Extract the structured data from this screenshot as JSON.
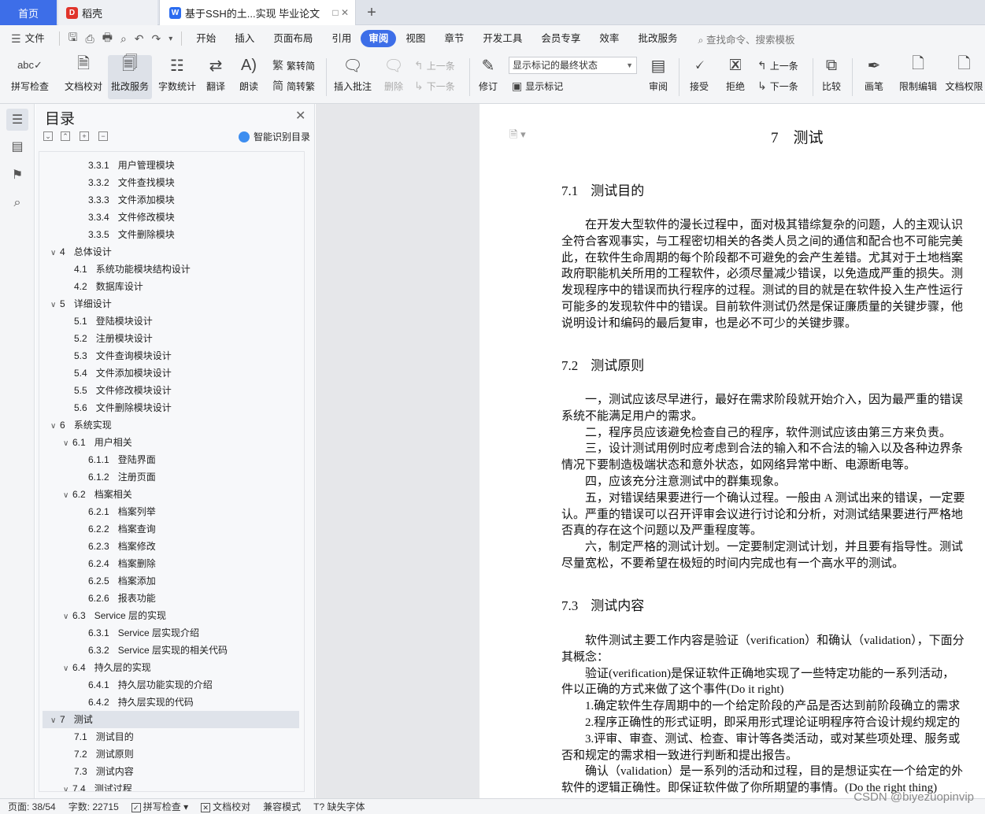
{
  "tabs": {
    "home": "首页",
    "daoke": "稻壳",
    "doc": "基于SSH的土...实现 毕业论文",
    "plus": "+"
  },
  "menu": {
    "file": "文件",
    "items": [
      "开始",
      "插入",
      "页面布局",
      "引用",
      "审阅",
      "视图",
      "章节",
      "开发工具",
      "会员专享",
      "效率",
      "批改服务"
    ],
    "active": "审阅",
    "search": "查找命令、搜索模板"
  },
  "ribbon": {
    "spell": "拼写检查",
    "proof": "文档校对",
    "revise_service": "批改服务",
    "word_count": "字数统计",
    "translate": "翻译",
    "read_aloud": "朗读",
    "to_traditional": "繁转简",
    "to_simplified": "简转繁",
    "insert_comment": "插入批注",
    "delete": "删除",
    "prev": "上一条",
    "next": "下一条",
    "track": "修订",
    "markup_state": "显示标记的最终状态",
    "show_markup": "显示标记",
    "review": "审阅",
    "accept": "接受",
    "reject": "拒绝",
    "prev2": "上一条",
    "next2": "下一条",
    "compare": "比较",
    "ink": "画笔",
    "restrict": "限制编辑",
    "doc_perm": "文档权限"
  },
  "toc": {
    "title": "目录",
    "smart": "智能识别目录",
    "items": [
      {
        "num": "3.3.1",
        "text": "用户管理模块",
        "level": 3
      },
      {
        "num": "3.3.2",
        "text": "文件查找模块",
        "level": 3
      },
      {
        "num": "3.3.3",
        "text": "文件添加模块",
        "level": 3
      },
      {
        "num": "3.3.4",
        "text": "文件修改模块",
        "level": 3
      },
      {
        "num": "3.3.5",
        "text": "文件删除模块",
        "level": 3
      },
      {
        "num": "4",
        "text": "总体设计",
        "level": 1
      },
      {
        "num": "4.1",
        "text": "系统功能模块结构设计",
        "level": 2
      },
      {
        "num": "4.2",
        "text": "数据库设计",
        "level": 2
      },
      {
        "num": "5",
        "text": "详细设计",
        "level": 1
      },
      {
        "num": "5.1",
        "text": "登陆模块设计",
        "level": 2
      },
      {
        "num": "5.2",
        "text": "注册模块设计",
        "level": 2
      },
      {
        "num": "5.3",
        "text": "文件查询模块设计",
        "level": 2
      },
      {
        "num": "5.4",
        "text": "文件添加模块设计",
        "level": 2
      },
      {
        "num": "5.5",
        "text": "文件修改模块设计",
        "level": 2
      },
      {
        "num": "5.6",
        "text": "文件删除模块设计",
        "level": 2
      },
      {
        "num": "6",
        "text": "系统实现",
        "level": 1
      },
      {
        "num": "6.1",
        "text": "用户相关",
        "level": 2,
        "expand": true
      },
      {
        "num": "6.1.1",
        "text": "登陆界面",
        "level": 3
      },
      {
        "num": "6.1.2",
        "text": "注册页面",
        "level": 3
      },
      {
        "num": "6.2",
        "text": "档案相关",
        "level": 2,
        "expand": true
      },
      {
        "num": "6.2.1",
        "text": "档案列举",
        "level": 3
      },
      {
        "num": "6.2.2",
        "text": "档案查询",
        "level": 3
      },
      {
        "num": "6.2.3",
        "text": "档案修改",
        "level": 3
      },
      {
        "num": "6.2.4",
        "text": "档案删除",
        "level": 3
      },
      {
        "num": "6.2.5",
        "text": "档案添加",
        "level": 3
      },
      {
        "num": "6.2.6",
        "text": "报表功能",
        "level": 3
      },
      {
        "num": "6.3",
        "text": "Service 层的实现",
        "level": 2,
        "expand": true
      },
      {
        "num": "6.3.1",
        "text": "Service 层实现介绍",
        "level": 3
      },
      {
        "num": "6.3.2",
        "text": "Service 层实现的相关代码",
        "level": 3
      },
      {
        "num": "6.4",
        "text": "持久层的实现",
        "level": 2,
        "expand": true
      },
      {
        "num": "6.4.1",
        "text": "持久层功能实现的介绍",
        "level": 3
      },
      {
        "num": "6.4.2",
        "text": "持久层实现的代码",
        "level": 3
      },
      {
        "num": "7",
        "text": "测试",
        "level": 1,
        "current": true
      },
      {
        "num": "7.1",
        "text": "测试目的",
        "level": 2
      },
      {
        "num": "7.2",
        "text": "测试原则",
        "level": 2
      },
      {
        "num": "7.3",
        "text": "测试内容",
        "level": 2
      },
      {
        "num": "7.4",
        "text": "测试过程",
        "level": 2,
        "expand": true
      }
    ]
  },
  "doc": {
    "chapter": "7　测试",
    "s1_num": "7.1",
    "s1_title": "测试目的",
    "s1_lines": [
      "　　在开发大型软件的漫长过程中，面对极其错综复杂的问题，人的主观认识",
      "全符合客观事实，与工程密切相关的各类人员之间的通信和配合也不可能完美",
      "此，在软件生命周期的每个阶段都不可避免的会产生差错。尤其对于土地档案",
      "政府职能机关所用的工程软件，必须尽量减少错误，以免造成严重的损失。测",
      "发现程序中的错误而执行程序的过程。测试的目的就是在软件投入生产性运行",
      "可能多的发现软件中的错误。目前软件测试仍然是保证廉质量的关键步骤，他",
      "说明设计和编码的最后复审，也是必不可少的关键步骤。"
    ],
    "s2_num": "7.2",
    "s2_title": "测试原则",
    "s2_lines": [
      "　　一，测试应该尽早进行，最好在需求阶段就开始介入，因为最严重的错误",
      "系统不能满足用户的需求。",
      "　　二，程序员应该避免检查自己的程序，软件测试应该由第三方来负责。",
      "　　三，设计测试用例时应考虑到合法的输入和不合法的输入以及各种边界条",
      "情况下要制造极端状态和意外状态，如网络异常中断、电源断电等。",
      "　　四，应该充分注意测试中的群集现象。",
      "　　五，对错误结果要进行一个确认过程。一般由 A 测试出来的错误，一定要",
      "认。严重的错误可以召开评审会议进行讨论和分析，对测试结果要进行严格地",
      "否真的存在这个问题以及严重程度等。",
      "　　六，制定严格的测试计划。一定要制定测试计划，并且要有指导性。测试",
      "尽量宽松，不要希望在极短的时间内完成也有一个高水平的测试。"
    ],
    "s3_num": "7.3",
    "s3_title": "测试内容",
    "s3_lines": [
      "　　软件测试主要工作内容是验证（verification）和确认（validation），下面分",
      "其概念：",
      "　　验证(verification)是保证软件正确地实现了一些特定功能的一系列活动，",
      "件以正确的方式来做了这个事件(Do it right)",
      "　　1.确定软件生存周期中的一个给定阶段的产品是否达到前阶段确立的需求",
      "　　2.程序正确性的形式证明，即采用形式理论证明程序符合设计规约规定的",
      "　　3.评审、审查、测试、检查、审计等各类活动，或对某些项处理、服务或",
      "否和规定的需求相一致进行判断和提出报告。",
      "　　确认（validation）是一系列的活动和过程，目的是想证实在一个给定的外",
      "软件的逻辑正确性。即保证软件做了你所期望的事情。(Do the right thing)"
    ]
  },
  "status": {
    "page": "页面: 38/54",
    "words": "字数: 22715",
    "spell": "拼写检查",
    "proof": "文档校对",
    "compat": "兼容模式",
    "missing_font": "缺失字体"
  },
  "watermark": "CSDN @biyezuopinvip"
}
